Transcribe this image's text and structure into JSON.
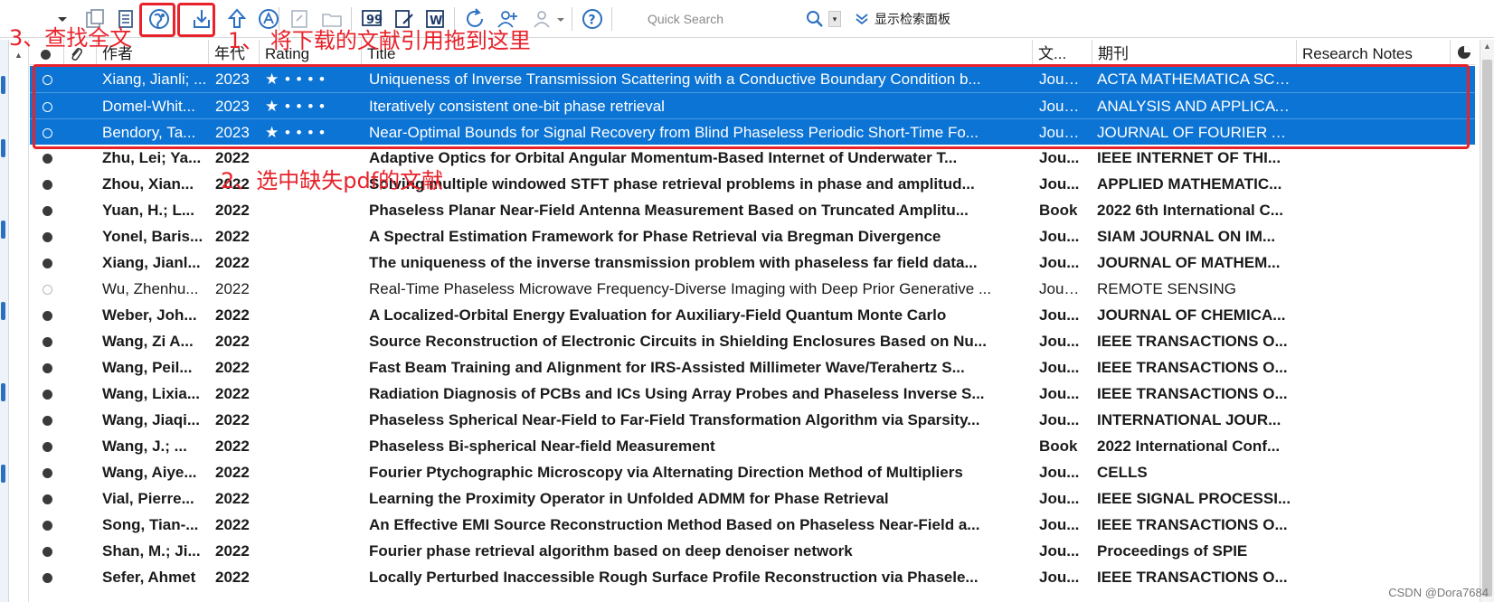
{
  "toolbar": {
    "search_placeholder": "Quick Search",
    "panel_toggle_label": "显示检索面板",
    "icons": [
      "filter-dropdown",
      "new-library",
      "layers",
      "find-full-text-globe",
      "import-download",
      "export-upload",
      "pdf-open",
      "link",
      "folder",
      "insert-citation-quote",
      "edit-document",
      "word-document",
      "sync",
      "add-user",
      "share-users",
      "help"
    ]
  },
  "annotations": {
    "step1": "1、 将下载的文献引用拖到这里",
    "step2": "2、选中缺失pdf的文献",
    "step3": "3、查找全文"
  },
  "columns": {
    "author": "作者",
    "year": "年代",
    "rating": "Rating",
    "title": "Title",
    "type": "文...",
    "journal": "期刊",
    "notes": "Research Notes"
  },
  "rows": [
    {
      "author": "Xiang, Jianli; ...",
      "year": "2023",
      "rating": "★ • • • •",
      "title": "Uniqueness of Inverse Transmission Scattering with a Conductive Boundary Condition b...",
      "type": "Jour...",
      "journal": "ACTA MATHEMATICA SCI...",
      "unread": false,
      "selected": true
    },
    {
      "author": "Domel-Whit...",
      "year": "2023",
      "rating": "★ • • • •",
      "title": "Iteratively consistent one-bit phase retrieval",
      "type": "Jour...",
      "journal": "ANALYSIS AND APPLICATI...",
      "unread": false,
      "selected": true
    },
    {
      "author": "Bendory, Ta...",
      "year": "2023",
      "rating": "★ • • • •",
      "title": "Near-Optimal Bounds for Signal Recovery from Blind Phaseless Periodic Short-Time Fo...",
      "type": "Jour...",
      "journal": "JOURNAL OF FOURIER A...",
      "unread": false,
      "selected": true
    },
    {
      "author": "Zhu, Lei; Ya...",
      "year": "2022",
      "rating": "",
      "title": "Adaptive Optics for Orbital Angular Momentum-Based Internet of Underwater T...",
      "type": "Jou...",
      "journal": "IEEE INTERNET OF THI...",
      "unread": true,
      "selected": false
    },
    {
      "author": "Zhou, Xian...",
      "year": "2022",
      "rating": "",
      "title": "Solving multiple windowed STFT phase retrieval problems in phase and amplitud...",
      "type": "Jou...",
      "journal": "APPLIED MATHEMATIC...",
      "unread": true,
      "selected": false
    },
    {
      "author": "Yuan, H.; L...",
      "year": "2022",
      "rating": "",
      "title": "Phaseless Planar Near-Field Antenna Measurement Based on Truncated Amplitu...",
      "type": "Book",
      "journal": "2022 6th International C...",
      "unread": true,
      "selected": false
    },
    {
      "author": "Yonel, Baris...",
      "year": "2022",
      "rating": "",
      "title": "A Spectral Estimation Framework for Phase Retrieval via Bregman Divergence",
      "type": "Jou...",
      "journal": "SIAM JOURNAL ON IM...",
      "unread": true,
      "selected": false
    },
    {
      "author": "Xiang, Jianl...",
      "year": "2022",
      "rating": "",
      "title": "The uniqueness of the inverse transmission problem with phaseless far field data...",
      "type": "Jou...",
      "journal": "JOURNAL OF MATHEM...",
      "unread": true,
      "selected": false
    },
    {
      "author": "Wu, Zhenhu...",
      "year": "2022",
      "rating": "",
      "title": "Real-Time Phaseless Microwave Frequency-Diverse Imaging with Deep Prior Generative ...",
      "type": "Jour...",
      "journal": "REMOTE SENSING",
      "unread": false,
      "selected": false
    },
    {
      "author": "Weber, Joh...",
      "year": "2022",
      "rating": "",
      "title": "A Localized-Orbital Energy Evaluation for Auxiliary-Field Quantum Monte Carlo",
      "type": "Jou...",
      "journal": "JOURNAL OF CHEMICA...",
      "unread": true,
      "selected": false
    },
    {
      "author": "Wang, Zi A...",
      "year": "2022",
      "rating": "",
      "title": "Source Reconstruction of Electronic Circuits in Shielding Enclosures Based on Nu...",
      "type": "Jou...",
      "journal": "IEEE TRANSACTIONS O...",
      "unread": true,
      "selected": false
    },
    {
      "author": "Wang, Peil...",
      "year": "2022",
      "rating": "",
      "title": "Fast Beam Training and Alignment for IRS-Assisted Millimeter Wave/Terahertz S...",
      "type": "Jou...",
      "journal": "IEEE TRANSACTIONS O...",
      "unread": true,
      "selected": false
    },
    {
      "author": "Wang, Lixia...",
      "year": "2022",
      "rating": "",
      "title": "Radiation Diagnosis of PCBs and ICs Using Array Probes and Phaseless Inverse S...",
      "type": "Jou...",
      "journal": "IEEE TRANSACTIONS O...",
      "unread": true,
      "selected": false
    },
    {
      "author": "Wang, Jiaqi...",
      "year": "2022",
      "rating": "",
      "title": "Phaseless Spherical Near-Field to Far-Field Transformation Algorithm via Sparsity...",
      "type": "Jou...",
      "journal": "INTERNATIONAL JOUR...",
      "unread": true,
      "selected": false
    },
    {
      "author": "Wang, J.; ...",
      "year": "2022",
      "rating": "",
      "title": "Phaseless Bi-spherical Near-field Measurement",
      "type": "Book",
      "journal": "2022 International Conf...",
      "unread": true,
      "selected": false
    },
    {
      "author": "Wang, Aiye...",
      "year": "2022",
      "rating": "",
      "title": "Fourier Ptychographic Microscopy via Alternating Direction Method of Multipliers",
      "type": "Jou...",
      "journal": "CELLS",
      "unread": true,
      "selected": false
    },
    {
      "author": "Vial, Pierre...",
      "year": "2022",
      "rating": "",
      "title": "Learning the Proximity Operator in Unfolded ADMM for Phase Retrieval",
      "type": "Jou...",
      "journal": "IEEE SIGNAL PROCESSI...",
      "unread": true,
      "selected": false
    },
    {
      "author": "Song, Tian-...",
      "year": "2022",
      "rating": "",
      "title": "An Effective EMI Source Reconstruction Method Based on Phaseless Near-Field a...",
      "type": "Jou...",
      "journal": "IEEE TRANSACTIONS O...",
      "unread": true,
      "selected": false
    },
    {
      "author": "Shan, M.; Ji...",
      "year": "2022",
      "rating": "",
      "title": "Fourier phase retrieval algorithm based on deep denoiser network",
      "type": "Jou...",
      "journal": "Proceedings of SPIE",
      "unread": true,
      "selected": false
    },
    {
      "author": "Sefer, Ahmet",
      "year": "2022",
      "rating": "",
      "title": "Locally Perturbed Inaccessible Rough Surface Profile Reconstruction via Phasele...",
      "type": "Jou...",
      "journal": "IEEE TRANSACTIONS O...",
      "unread": true,
      "selected": false
    }
  ],
  "watermark": "CSDN @Dora7684",
  "colors": {
    "selection": "#0c74d4",
    "annotation": "#e8222b",
    "icon_blue": "#2b6fc0"
  }
}
